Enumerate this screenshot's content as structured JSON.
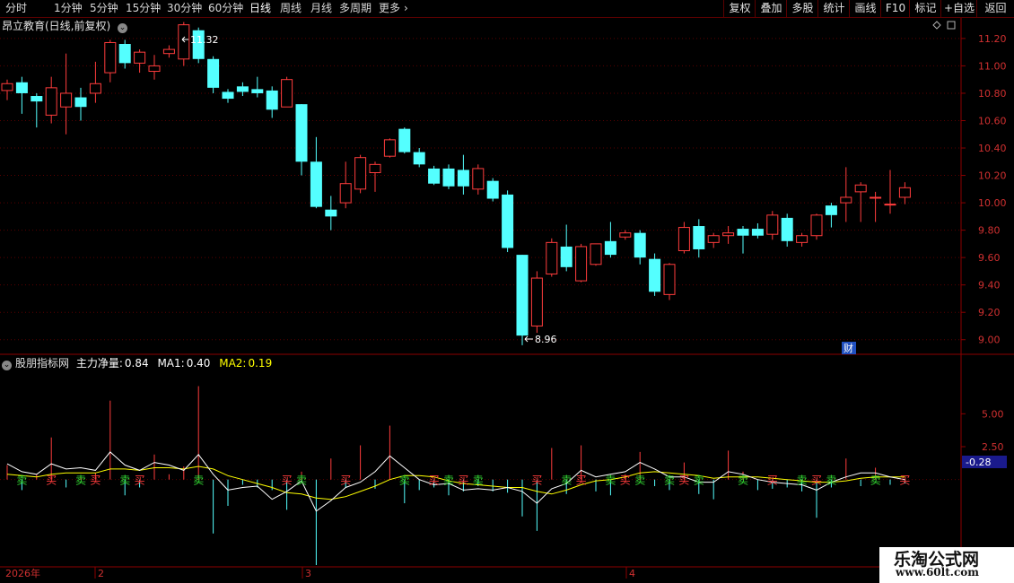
{
  "toolbar": {
    "periods": [
      "分时",
      "1分钟",
      "5分钟",
      "15分钟",
      "30分钟",
      "60分钟",
      "日线",
      "周线",
      "月线",
      "多周期",
      "更多"
    ],
    "active_period": "日线",
    "more_arrow": "›",
    "right_buttons": [
      "复权",
      "叠加",
      "多股",
      "统计",
      "画线",
      "F10",
      "标记",
      "+自选",
      "返回"
    ]
  },
  "main_panel": {
    "title": "昂立教育(日线,前复权)",
    "high_label": "11.32",
    "low_label": "8.96",
    "cai_badge": "财",
    "price_ticks": [
      "11.20",
      "11.00",
      "10.80",
      "10.60",
      "10.40",
      "10.20",
      "10.00",
      "9.80",
      "9.60",
      "9.40",
      "9.20",
      "9.00"
    ]
  },
  "indicator_panel": {
    "name": "股朋指标网",
    "main_label": "主力净量:",
    "main_value": "0.84",
    "ma1_label": "MA1:",
    "ma1_value": "0.40",
    "ma2_label": "MA2:",
    "ma2_value": "0.19",
    "ticks": [
      "5.00",
      "2.50"
    ],
    "current_value": "-0.28",
    "buy_label": "买",
    "sell_label": "卖"
  },
  "date_axis": {
    "year": "2026年",
    "months": [
      "2",
      "3",
      "4"
    ]
  },
  "watermark": {
    "name": "乐淘公式网",
    "url": "www.60lt.com"
  },
  "colors": {
    "up": "#ff3c3c",
    "down": "#54ffff",
    "ma1": "#ffffff",
    "ma2": "#ffff00",
    "grid": "#8b0000"
  },
  "chart_data": {
    "type": "candlestick",
    "price_axis_range": [
      8.9,
      11.35
    ],
    "candles": [
      {
        "o": 10.82,
        "c": 10.87,
        "h": 10.9,
        "l": 10.75
      },
      {
        "o": 10.88,
        "c": 10.8,
        "h": 10.92,
        "l": 10.65
      },
      {
        "o": 10.78,
        "c": 10.74,
        "h": 10.8,
        "l": 10.55
      },
      {
        "o": 10.64,
        "c": 10.84,
        "h": 10.92,
        "l": 10.58
      },
      {
        "o": 10.7,
        "c": 10.8,
        "h": 11.09,
        "l": 10.5
      },
      {
        "o": 10.77,
        "c": 10.7,
        "h": 10.84,
        "l": 10.6
      },
      {
        "o": 10.8,
        "c": 10.87,
        "h": 11.03,
        "l": 10.73
      },
      {
        "o": 10.95,
        "c": 11.17,
        "h": 11.19,
        "l": 10.88
      },
      {
        "o": 11.16,
        "c": 11.02,
        "h": 11.19,
        "l": 10.98
      },
      {
        "o": 11.02,
        "c": 11.1,
        "h": 11.12,
        "l": 10.95
      },
      {
        "o": 10.96,
        "c": 11.0,
        "h": 11.08,
        "l": 10.9
      },
      {
        "o": 11.09,
        "c": 11.12,
        "h": 11.15,
        "l": 11.06
      },
      {
        "o": 11.05,
        "c": 11.3,
        "h": 11.32,
        "l": 11.0
      },
      {
        "o": 11.26,
        "c": 11.05,
        "h": 11.28,
        "l": 11.02
      },
      {
        "o": 11.05,
        "c": 10.84,
        "h": 11.07,
        "l": 10.8
      },
      {
        "o": 10.81,
        "c": 10.76,
        "h": 10.83,
        "l": 10.73
      },
      {
        "o": 10.85,
        "c": 10.81,
        "h": 10.88,
        "l": 10.78
      },
      {
        "o": 10.83,
        "c": 10.8,
        "h": 10.92,
        "l": 10.77
      },
      {
        "o": 10.82,
        "c": 10.68,
        "h": 10.85,
        "l": 10.62
      },
      {
        "o": 10.7,
        "c": 10.9,
        "h": 10.92,
        "l": 10.7
      },
      {
        "o": 10.72,
        "c": 10.3,
        "h": 10.72,
        "l": 10.2
      },
      {
        "o": 10.3,
        "c": 9.97,
        "h": 10.48,
        "l": 9.96
      },
      {
        "o": 9.95,
        "c": 9.9,
        "h": 10.05,
        "l": 9.8
      },
      {
        "o": 10.0,
        "c": 10.14,
        "h": 10.3,
        "l": 9.96
      },
      {
        "o": 10.1,
        "c": 10.33,
        "h": 10.35,
        "l": 10.07
      },
      {
        "o": 10.22,
        "c": 10.28,
        "h": 10.3,
        "l": 10.08
      },
      {
        "o": 10.34,
        "c": 10.46,
        "h": 10.47,
        "l": 10.33
      },
      {
        "o": 10.54,
        "c": 10.37,
        "h": 10.55,
        "l": 10.36
      },
      {
        "o": 10.37,
        "c": 10.28,
        "h": 10.4,
        "l": 10.26
      },
      {
        "o": 10.25,
        "c": 10.14,
        "h": 10.27,
        "l": 10.13
      },
      {
        "o": 10.25,
        "c": 10.12,
        "h": 10.28,
        "l": 10.1
      },
      {
        "o": 10.24,
        "c": 10.12,
        "h": 10.35,
        "l": 10.06
      },
      {
        "o": 10.1,
        "c": 10.25,
        "h": 10.28,
        "l": 10.06
      },
      {
        "o": 10.16,
        "c": 10.03,
        "h": 10.18,
        "l": 10.01
      },
      {
        "o": 10.06,
        "c": 9.67,
        "h": 10.09,
        "l": 9.64
      },
      {
        "o": 9.62,
        "c": 9.03,
        "h": 9.62,
        "l": 8.96
      },
      {
        "o": 9.1,
        "c": 9.45,
        "h": 9.5,
        "l": 9.05
      },
      {
        "o": 9.48,
        "c": 9.71,
        "h": 9.74,
        "l": 9.46
      },
      {
        "o": 9.68,
        "c": 9.53,
        "h": 9.84,
        "l": 9.5
      },
      {
        "o": 9.43,
        "c": 9.68,
        "h": 9.7,
        "l": 9.42
      },
      {
        "o": 9.55,
        "c": 9.7,
        "h": 9.7,
        "l": 9.54
      },
      {
        "o": 9.72,
        "c": 9.62,
        "h": 9.86,
        "l": 9.6
      },
      {
        "o": 9.75,
        "c": 9.78,
        "h": 9.8,
        "l": 9.73
      },
      {
        "o": 9.78,
        "c": 9.6,
        "h": 9.8,
        "l": 9.55
      },
      {
        "o": 9.59,
        "c": 9.35,
        "h": 9.63,
        "l": 9.32
      },
      {
        "o": 9.33,
        "c": 9.55,
        "h": 9.56,
        "l": 9.29
      },
      {
        "o": 9.65,
        "c": 9.82,
        "h": 9.86,
        "l": 9.63
      },
      {
        "o": 9.83,
        "c": 9.66,
        "h": 9.88,
        "l": 9.6
      },
      {
        "o": 9.71,
        "c": 9.76,
        "h": 9.78,
        "l": 9.67
      },
      {
        "o": 9.76,
        "c": 9.78,
        "h": 9.83,
        "l": 9.7
      },
      {
        "o": 9.81,
        "c": 9.76,
        "h": 9.83,
        "l": 9.63
      },
      {
        "o": 9.81,
        "c": 9.76,
        "h": 9.85,
        "l": 9.74
      },
      {
        "o": 9.77,
        "c": 9.91,
        "h": 9.94,
        "l": 9.73
      },
      {
        "o": 9.89,
        "c": 9.72,
        "h": 9.92,
        "l": 9.68
      },
      {
        "o": 9.71,
        "c": 9.76,
        "h": 9.78,
        "l": 9.68
      },
      {
        "o": 9.76,
        "c": 9.91,
        "h": 9.92,
        "l": 9.73
      },
      {
        "o": 9.98,
        "c": 9.91,
        "h": 10.0,
        "l": 9.82
      },
      {
        "o": 10.0,
        "c": 10.04,
        "h": 10.26,
        "l": 9.86
      },
      {
        "o": 10.08,
        "c": 10.13,
        "h": 10.15,
        "l": 9.86
      },
      {
        "o": 10.04,
        "c": 10.04,
        "h": 10.08,
        "l": 9.86
      },
      {
        "o": 9.99,
        "c": 9.99,
        "h": 10.24,
        "l": 9.92
      },
      {
        "o": 10.04,
        "c": 10.11,
        "h": 10.15,
        "l": 9.99
      }
    ],
    "indicator_axis_range": [
      -6.5,
      8.5
    ],
    "net_flow": [
      1.1,
      -0.8,
      0.4,
      3.2,
      -0.6,
      0.3,
      0.5,
      6.0,
      -1.2,
      -0.6,
      1.9,
      0.4,
      1.0,
      7.1,
      -4.1,
      -2.0,
      -0.4,
      -0.6,
      -0.8,
      -2.3,
      0.6,
      -6.5,
      1.6,
      -0.6,
      2.6,
      -0.7,
      4.1,
      -1.8,
      -0.8,
      -0.6,
      -1.2,
      -0.9,
      -0.5,
      -0.9,
      -1.0,
      -2.8,
      -3.9,
      2.4,
      -1.1,
      2.6,
      -0.9,
      -1.2,
      0.4,
      2.1,
      -0.5,
      -0.8,
      1.3,
      -1.1,
      -1.5,
      2.2,
      0.6,
      -0.8,
      -0.7,
      -0.6,
      -0.9,
      -2.9,
      -0.6,
      1.6,
      -0.5,
      0.9,
      -0.4,
      -0.3
    ],
    "ma1": [
      1.2,
      0.6,
      0.4,
      1.2,
      0.8,
      0.9,
      0.7,
      2.1,
      1.1,
      0.7,
      1.3,
      1.1,
      0.7,
      1.9,
      0.4,
      -0.8,
      -0.6,
      -0.5,
      -1.5,
      -0.9,
      -0.1,
      -2.4,
      -1.6,
      -0.6,
      -0.2,
      0.6,
      1.8,
      0.9,
      0.0,
      -0.4,
      -0.3,
      -0.8,
      -0.7,
      -0.8,
      -0.6,
      -0.9,
      -1.8,
      -0.7,
      -0.3,
      0.7,
      0.2,
      0.4,
      0.6,
      1.3,
      0.8,
      0.2,
      0.2,
      -0.2,
      -0.2,
      0.6,
      0.4,
      0.0,
      -0.2,
      -0.3,
      -0.4,
      -0.8,
      -0.2,
      0.2,
      0.5,
      0.5,
      0.2,
      0.0
    ],
    "ma2": [
      0.4,
      0.3,
      0.2,
      0.4,
      0.5,
      0.5,
      0.5,
      0.8,
      0.8,
      0.7,
      0.9,
      0.9,
      0.8,
      1.0,
      0.8,
      0.3,
      0.0,
      -0.3,
      -0.6,
      -1.0,
      -1.1,
      -1.4,
      -1.5,
      -1.3,
      -0.9,
      -0.5,
      0.0,
      0.3,
      0.3,
      0.2,
      -0.1,
      -0.3,
      -0.4,
      -0.5,
      -0.6,
      -0.6,
      -0.9,
      -1.1,
      -0.8,
      -0.4,
      -0.1,
      0.0,
      0.2,
      0.5,
      0.6,
      0.5,
      0.4,
      0.3,
      0.1,
      0.2,
      0.2,
      0.2,
      0.1,
      0.0,
      -0.1,
      -0.2,
      -0.2,
      -0.1,
      0.1,
      0.2,
      0.2,
      0.2
    ],
    "signals": [
      "",
      "卖",
      "",
      "买",
      "",
      "卖",
      "买",
      "",
      "卖",
      "买",
      "",
      "",
      "",
      "卖",
      "",
      "",
      "",
      "",
      "",
      "买",
      "卖",
      "",
      "",
      "买",
      "",
      "",
      "",
      "卖",
      "",
      "买",
      "卖",
      "买",
      "卖",
      "",
      "",
      "",
      "买",
      "",
      "卖",
      "买",
      "",
      "卖",
      "买",
      "卖",
      "",
      "卖",
      "买",
      "卖",
      "",
      "",
      "卖",
      "",
      "买",
      "",
      "卖",
      "买",
      "卖",
      "",
      "",
      "卖",
      "",
      "买"
    ],
    "date_ticks": [
      "2026年",
      "2",
      "3",
      "4"
    ]
  }
}
